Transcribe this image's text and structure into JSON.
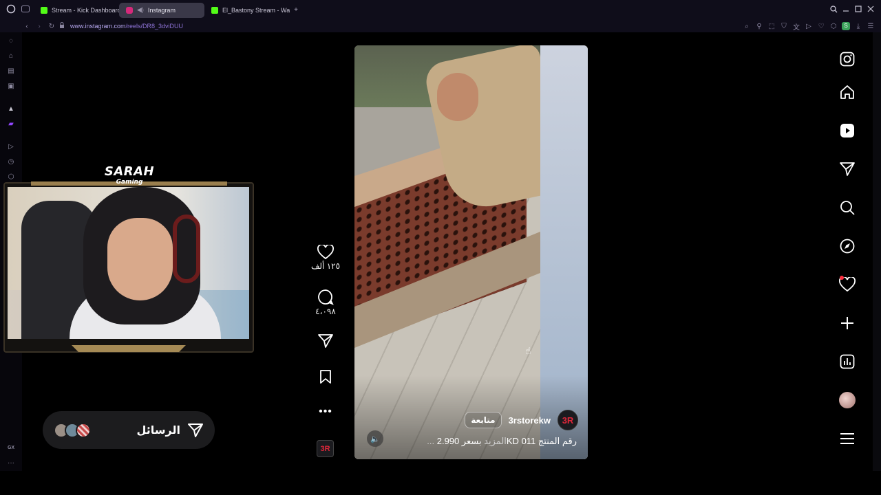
{
  "browser": {
    "tabs": [
      {
        "label": "Stream - Kick Dashboard",
        "color": "#53fc18",
        "active": false
      },
      {
        "label": "Instagram",
        "color": "#d6297a",
        "active": true
      },
      {
        "label": "El_Bastony Stream - Wat",
        "color": "#53fc18",
        "active": false
      }
    ],
    "new_tab_label": "+",
    "url_host": "www.instagram.com",
    "url_path": "/reels/DR8_3dviDUU"
  },
  "reel": {
    "author": "3rstorekw",
    "author_avatar_text": "3R",
    "follow_label": "متابعة",
    "caption": "بسعر 2.990KD رقم المنتج 011",
    "caption_more": "... المزيد"
  },
  "actions": {
    "likes": "١٢٥ ألف",
    "comments": "٤،٠٩٨",
    "avatar_text": "3R"
  },
  "messages": {
    "label": "الرسائل"
  },
  "overlay": {
    "brand_title": "SARAH",
    "brand_subtitle": "Gaming"
  },
  "sidebar_bottom": {
    "gx_label": "GX",
    "more_label": "···"
  },
  "colors": {
    "notification": "#ff3040",
    "brand_red": "#e0273a",
    "url_accent": "#8f74d8"
  }
}
